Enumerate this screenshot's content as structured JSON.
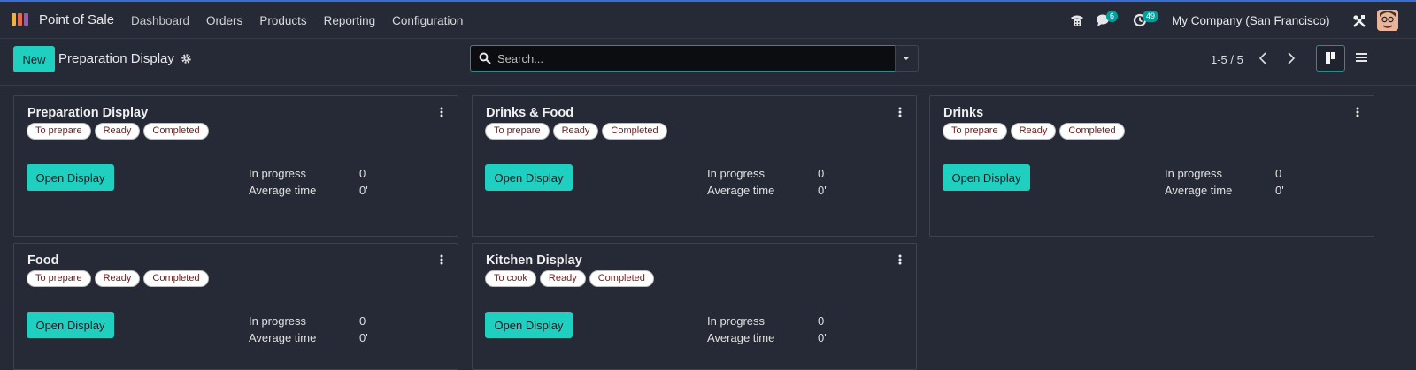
{
  "navbar": {
    "app_name": "Point of Sale",
    "menu": [
      "Dashboard",
      "Orders",
      "Products",
      "Reporting",
      "Configuration"
    ],
    "chat_badge": "6",
    "activity_badge": "49",
    "company": "My Company (San Francisco)"
  },
  "control": {
    "new_label": "New",
    "title": "Preparation Display",
    "search_placeholder": "Search...",
    "pager": "1-5 / 5"
  },
  "cards": [
    {
      "title": "Preparation Display",
      "tags": [
        "To prepare",
        "Ready",
        "Completed"
      ],
      "button": "Open Display",
      "in_progress_label": "In progress",
      "in_progress": "0",
      "avg_label": "Average time",
      "avg": "0'"
    },
    {
      "title": "Drinks & Food",
      "tags": [
        "To prepare",
        "Ready",
        "Completed"
      ],
      "button": "Open Display",
      "in_progress_label": "In progress",
      "in_progress": "0",
      "avg_label": "Average time",
      "avg": "0'"
    },
    {
      "title": "Drinks",
      "tags": [
        "To prepare",
        "Ready",
        "Completed"
      ],
      "button": "Open Display",
      "in_progress_label": "In progress",
      "in_progress": "0",
      "avg_label": "Average time",
      "avg": "0'"
    },
    {
      "title": "Food",
      "tags": [
        "To prepare",
        "Ready",
        "Completed"
      ],
      "button": "Open Display",
      "in_progress_label": "In progress",
      "in_progress": "0",
      "avg_label": "Average time",
      "avg": "0'"
    },
    {
      "title": "Kitchen Display",
      "tags": [
        "To cook",
        "Ready",
        "Completed"
      ],
      "button": "Open Display",
      "in_progress_label": "In progress",
      "in_progress": "0",
      "avg_label": "Average time",
      "avg": "0'"
    }
  ],
  "colors": {
    "accent": "#1fcfc0",
    "background": "#262a36",
    "badge": "#00a09d"
  },
  "icons": [
    "pos-logo-icon",
    "phone-icon",
    "chat-icon",
    "activity-clock-icon",
    "tools-icon",
    "gear-icon",
    "search-icon",
    "caret-down-icon",
    "chevron-left-icon",
    "chevron-right-icon",
    "kanban-view-icon",
    "list-view-icon",
    "kebab-menu-icon"
  ]
}
